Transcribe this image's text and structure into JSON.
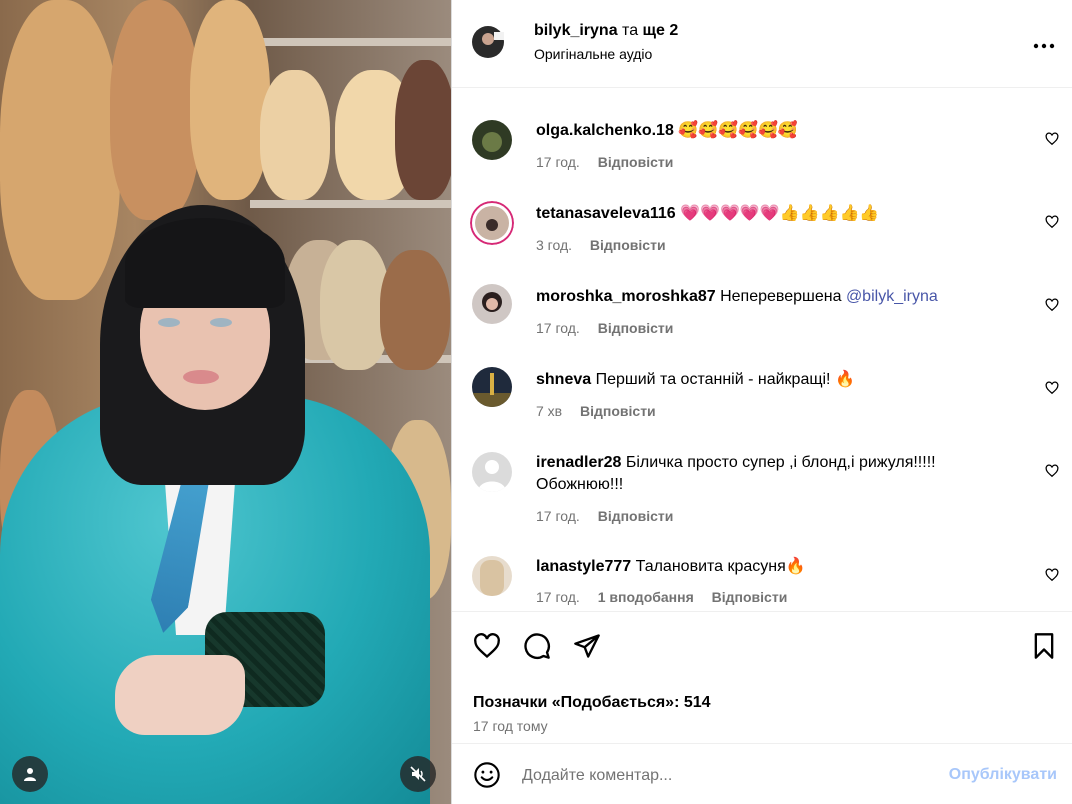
{
  "header": {
    "author_name": "bilyk_iryna",
    "author_suffix": " та ",
    "author_more": "ще 2",
    "audio": "Оригінальне аудіо",
    "more_icon": "more-horizontal-icon"
  },
  "comments": [
    {
      "user": "olga.kalchenko.18",
      "text": "🥰🥰🥰🥰🥰🥰",
      "time": "17 год.",
      "reply": "Відповісти",
      "likes": ""
    },
    {
      "user": "tetanasaveleva116",
      "text": "💗💗💗💗💗👍👍👍👍👍",
      "time": "3 год.",
      "reply": "Відповісти",
      "likes": ""
    },
    {
      "user": "moroshka_moroshka87",
      "text": "Неперевершена ",
      "mention": "@bilyk_iryna",
      "time": "17 год.",
      "reply": "Відповісти",
      "likes": ""
    },
    {
      "user": "shneva",
      "text": "Перший та останній - найкращі! 🔥",
      "time": "7 хв",
      "reply": "Відповісти",
      "likes": ""
    },
    {
      "user": "irenadler28",
      "text": "Біличка просто супер ,і блонд,і рижуля!!!!! Обожнюю!!!",
      "time": "17 год.",
      "reply": "Відповісти",
      "likes": ""
    },
    {
      "user": "lanastyle777",
      "text": "Талановита красуня🔥",
      "time": "17 год.",
      "reply": "Відповісти",
      "likes": "1 вподобання"
    }
  ],
  "actions": {
    "like_icon": "heart-icon",
    "comment_icon": "comment-icon",
    "share_icon": "send-icon",
    "save_icon": "bookmark-icon",
    "likes_text": "Позначки «Подобається»: 514",
    "post_time": "17 год тому"
  },
  "composer": {
    "placeholder": "Додайте коментар...",
    "publish_label": "Опублікувати",
    "emoji_icon": "emoji-icon"
  },
  "media": {
    "user_tag_icon": "user-tag-icon",
    "mute_icon": "mute-icon"
  },
  "colors": {
    "accent_disabled": "#a8c7fa",
    "muted_text": "#737373",
    "mention": "#4856a8"
  }
}
